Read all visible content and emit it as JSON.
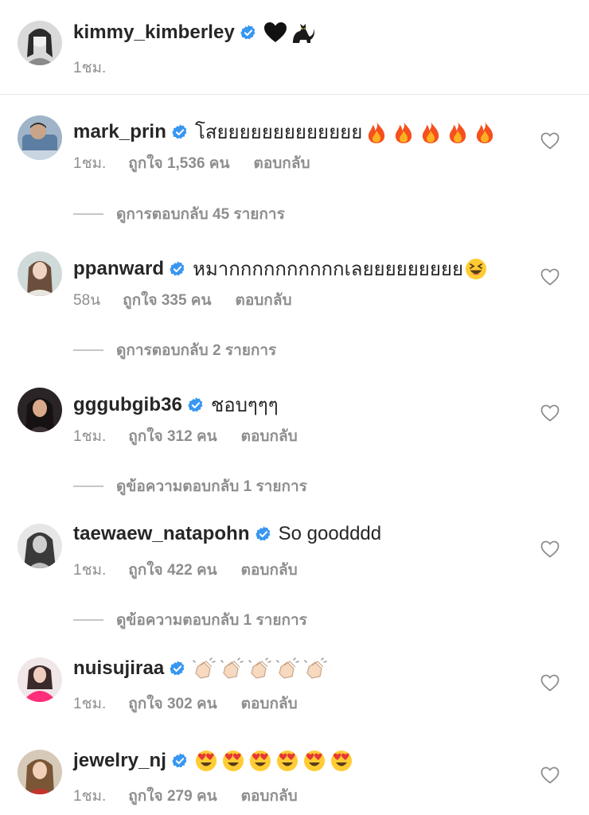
{
  "caption": {
    "username": "kimmy_kimberley",
    "text": "",
    "emoji": [
      "black-heart",
      "black-cat"
    ],
    "time": "1ชม."
  },
  "comments": [
    {
      "username": "mark_prin",
      "text": "โสยยยยยยยยยยยยย",
      "emoji": [
        "fire",
        "fire",
        "fire",
        "fire",
        "fire"
      ],
      "time": "1ชม.",
      "likes": "ถูกใจ 1,536 คน",
      "reply": "ตอบกลับ",
      "view_replies": "ดูการตอบกลับ 45 รายการ"
    },
    {
      "username": "ppanward",
      "text": "หมากกกกกกกกกกเลยยยยยยยยย",
      "emoji": [
        "laughing"
      ],
      "time": "58น",
      "likes": "ถูกใจ 335 คน",
      "reply": "ตอบกลับ",
      "view_replies": "ดูการตอบกลับ 2 รายการ"
    },
    {
      "username": "gggubgib36",
      "text": "ชอบๆๆๆ",
      "emoji": [],
      "time": "1ชม.",
      "likes": "ถูกใจ 312 คน",
      "reply": "ตอบกลับ",
      "view_replies": "ดูข้อความตอบกลับ 1 รายการ"
    },
    {
      "username": "taewaew_natapohn",
      "text": "So goodddd",
      "emoji": [],
      "time": "1ชม.",
      "likes": "ถูกใจ 422 คน",
      "reply": "ตอบกลับ",
      "view_replies": "ดูข้อความตอบกลับ 1 รายการ"
    },
    {
      "username": "nuisujiraa",
      "text": "",
      "emoji": [
        "clap",
        "clap",
        "clap",
        "clap",
        "clap"
      ],
      "time": "1ชม.",
      "likes": "ถูกใจ 302 คน",
      "reply": "ตอบกลับ",
      "view_replies": ""
    },
    {
      "username": "jewelry_nj",
      "text": "",
      "emoji": [
        "heart-eyes",
        "heart-eyes",
        "heart-eyes",
        "heart-eyes",
        "heart-eyes",
        "heart-eyes"
      ],
      "time": "1ชม.",
      "likes": "ถูกใจ 279 คน",
      "reply": "ตอบกลับ",
      "view_replies": ""
    }
  ],
  "colors": {
    "username": "#262626",
    "meta": "#8e8e8e",
    "verified": "#3897f0",
    "divider": "#e6e6e6"
  },
  "icons": [
    "verified-badge-icon",
    "heart-outline-icon"
  ]
}
